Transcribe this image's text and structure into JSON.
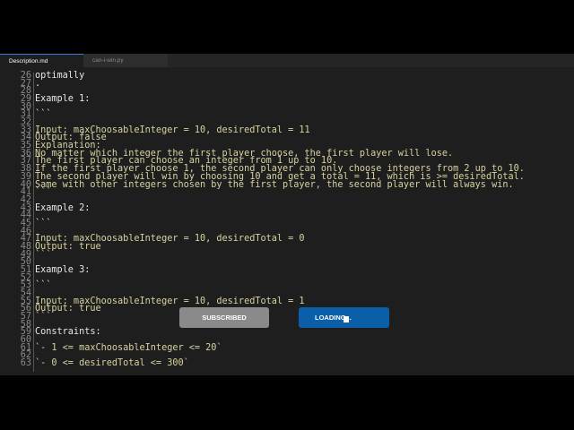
{
  "tabs": [
    {
      "label": "Description.md",
      "active": true
    },
    {
      "label": "can-i-win.py",
      "active": false
    }
  ],
  "lines": [
    {
      "n": "26",
      "t": "optimally",
      "y": false
    },
    {
      "n": "27",
      "t": ".",
      "y": false
    },
    {
      "n": "28",
      "t": "",
      "y": false
    },
    {
      "n": "29",
      "t": "Example 1:",
      "y": false
    },
    {
      "n": "30",
      "t": "",
      "y": false
    },
    {
      "n": "31",
      "t": "```",
      "y": false
    },
    {
      "n": "32",
      "t": "",
      "y": false
    },
    {
      "n": "33",
      "t": "Input: maxChoosableInteger = 10, desiredTotal = 11",
      "y": true
    },
    {
      "n": "34",
      "t": "Output: false",
      "y": true
    },
    {
      "n": "35",
      "t": "Explanation:",
      "y": true
    },
    {
      "n": "36",
      "t": "No matter which integer the first player choose, the first player will lose.",
      "y": true
    },
    {
      "n": "37",
      "t": "The first player can choose an integer from 1 up to 10.",
      "y": true
    },
    {
      "n": "38",
      "t": "If the first player choose 1, the second player can only choose integers from 2 up to 10.",
      "y": true
    },
    {
      "n": "39",
      "t": "The second player will win by choosing 10 and get a total = 11, which is >= desiredTotal.",
      "y": true
    },
    {
      "n": "40",
      "t": "Same with other integers chosen by the first player, the second player will always win.",
      "y": true
    },
    {
      "n": "41",
      "t": "```",
      "y": true
    },
    {
      "n": "42",
      "t": "",
      "y": false
    },
    {
      "n": "43",
      "t": "Example 2:",
      "y": false
    },
    {
      "n": "44",
      "t": "",
      "y": false
    },
    {
      "n": "45",
      "t": "```",
      "y": false
    },
    {
      "n": "46",
      "t": "",
      "y": false
    },
    {
      "n": "47",
      "t": "Input: maxChoosableInteger = 10, desiredTotal = 0",
      "y": true
    },
    {
      "n": "48",
      "t": "Output: true",
      "y": true
    },
    {
      "n": "49",
      "t": "```",
      "y": true
    },
    {
      "n": "50",
      "t": "",
      "y": false
    },
    {
      "n": "51",
      "t": "Example 3:",
      "y": false
    },
    {
      "n": "52",
      "t": "",
      "y": false
    },
    {
      "n": "53",
      "t": "```",
      "y": false
    },
    {
      "n": "54",
      "t": "",
      "y": false
    },
    {
      "n": "55",
      "t": "Input: maxChoosableInteger = 10, desiredTotal = 1",
      "y": true
    },
    {
      "n": "56",
      "t": "Output: true",
      "y": true
    },
    {
      "n": "57",
      "t": "```",
      "y": true
    },
    {
      "n": "58",
      "t": "",
      "y": false
    },
    {
      "n": "59",
      "t": "Constraints:",
      "y": false
    },
    {
      "n": "60",
      "t": "",
      "y": false
    },
    {
      "n": "61",
      "t": "`- 1 <= maxChoosableInteger <= 20`",
      "y": true
    },
    {
      "n": "62",
      "t": "",
      "y": false
    },
    {
      "n": "63",
      "t": "`- 0 <= desiredTotal <= 300`",
      "y": true
    }
  ],
  "overlay": {
    "subscribed_label": "SUBSCRIBED",
    "loading_label": "LOADING..."
  },
  "colors": {
    "accent": "#0b5ea8",
    "subscribed": "#8a8a8a"
  }
}
